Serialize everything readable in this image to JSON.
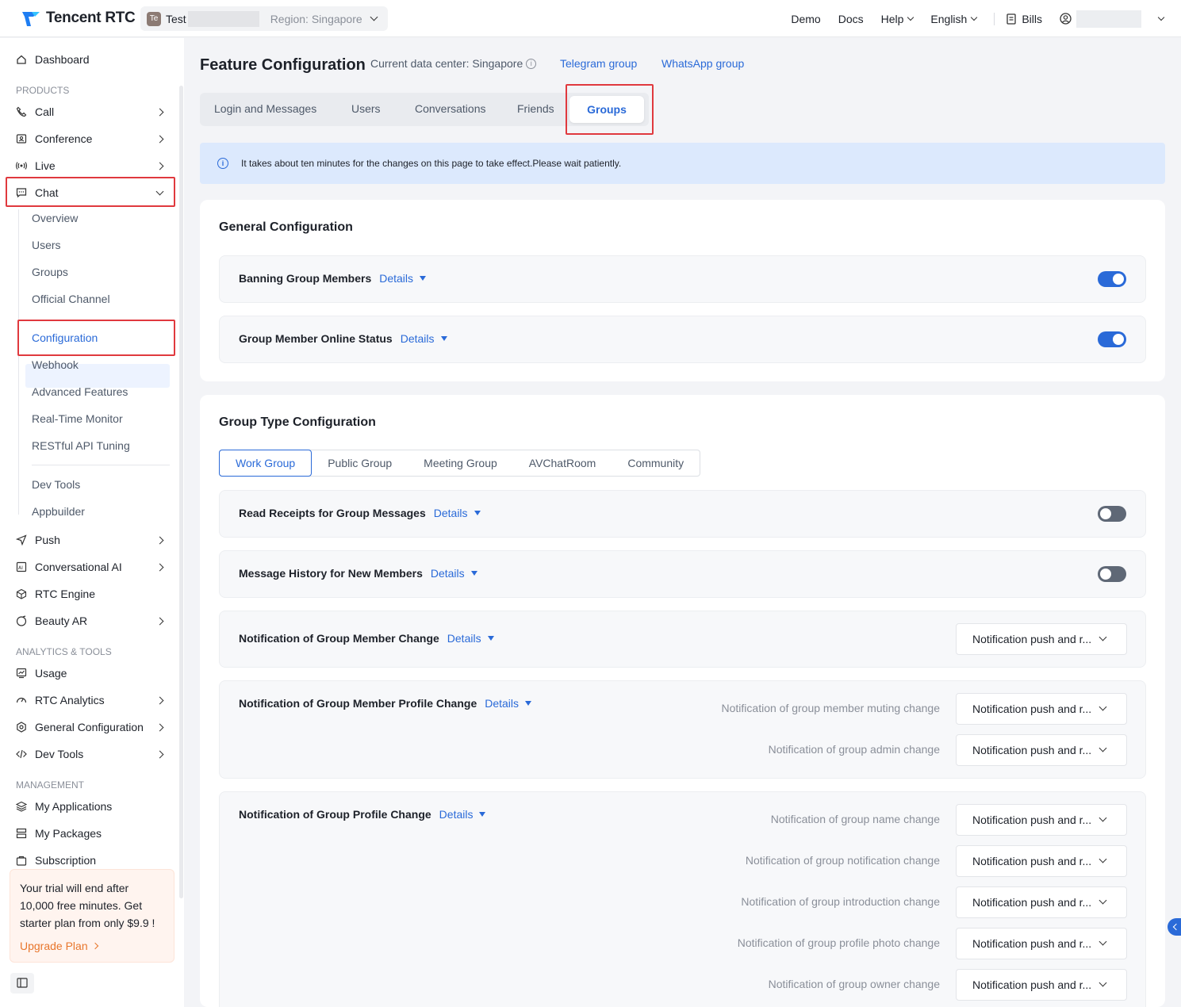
{
  "brand": {
    "name": "Tencent RTC"
  },
  "app_selector": {
    "badge": "Te",
    "app_name": "Test",
    "region": "Region: Singapore"
  },
  "top_nav": {
    "demo": "Demo",
    "docs": "Docs",
    "help": "Help",
    "language": "English",
    "bills": "Bills"
  },
  "sidebar": {
    "dashboard": "Dashboard",
    "products_header": "PRODUCTS",
    "call": "Call",
    "conference": "Conference",
    "live": "Live",
    "chat": "Chat",
    "chat_items": [
      "Overview",
      "Users",
      "Groups",
      "Official Channel",
      "Configuration",
      "Webhook",
      "Advanced Features",
      "Real-Time Monitor",
      "RESTful API Tuning",
      "Dev Tools",
      "Appbuilder"
    ],
    "push": "Push",
    "conversational_ai": "Conversational AI",
    "rtc_engine": "RTC Engine",
    "beauty_ar": "Beauty AR",
    "analytics_header": "ANALYTICS & TOOLS",
    "usage": "Usage",
    "rtc_analytics": "RTC Analytics",
    "general_configuration": "General Configuration",
    "dev_tools": "Dev Tools",
    "management_header": "MANAGEMENT",
    "my_applications": "My Applications",
    "my_packages": "My Packages",
    "subscription": "Subscription",
    "trial": {
      "text": "Your trial will end after 10,000 free minutes. Get starter plan from only $9.9 !",
      "upgrade": "Upgrade Plan"
    }
  },
  "header": {
    "title": "Feature Configuration",
    "data_center": "Current data center: Singapore",
    "telegram": "Telegram group",
    "whatsapp": "WhatsApp group"
  },
  "tabs": [
    "Login and Messages",
    "Users",
    "Conversations",
    "Friends",
    "Groups"
  ],
  "active_tab": "Groups",
  "notice": "It takes about ten minutes for the changes on this page to take effect.Please wait patiently.",
  "general_config": {
    "title": "General Configuration",
    "rows": [
      {
        "label": "Banning Group Members",
        "details": "Details",
        "enabled": true
      },
      {
        "label": "Group Member Online Status",
        "details": "Details",
        "enabled": true
      }
    ]
  },
  "group_type_config": {
    "title": "Group Type Configuration",
    "types": [
      "Work Group",
      "Public Group",
      "Meeting Group",
      "AVChatRoom",
      "Community"
    ],
    "active_type": "Work Group",
    "read_receipts": {
      "label": "Read Receipts for Group Messages",
      "details": "Details",
      "enabled": false
    },
    "message_history": {
      "label": "Message History for New Members",
      "details": "Details",
      "enabled": false
    },
    "member_change": {
      "label": "Notification of Group Member Change",
      "details": "Details",
      "value": "Notification push and r..."
    },
    "member_profile_change": {
      "label": "Notification of Group Member Profile Change",
      "details": "Details",
      "items": [
        {
          "label": "Notification of group member muting change",
          "value": "Notification push and r..."
        },
        {
          "label": "Notification of group admin change",
          "value": "Notification push and r..."
        }
      ]
    },
    "group_profile_change": {
      "label": "Notification of Group Profile Change",
      "details": "Details",
      "items": [
        {
          "label": "Notification of group name change",
          "value": "Notification push and r..."
        },
        {
          "label": "Notification of group notification change",
          "value": "Notification push and r..."
        },
        {
          "label": "Notification of group introduction change",
          "value": "Notification push and r..."
        },
        {
          "label": "Notification of group profile photo change",
          "value": "Notification push and r..."
        },
        {
          "label": "Notification of group owner change",
          "value": "Notification push and r..."
        }
      ]
    }
  },
  "colors": {
    "accent": "#2a6ad8",
    "highlight": "#e0393e",
    "toggle_off": "#5f6876",
    "notice_bg": "#dce9fd"
  }
}
